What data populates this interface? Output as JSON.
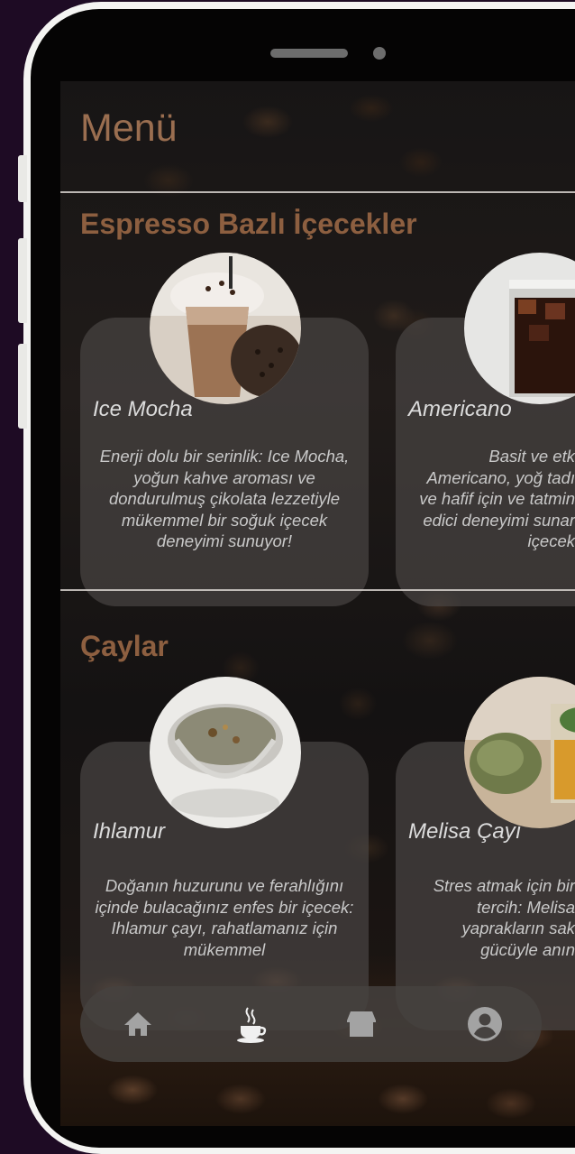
{
  "page": {
    "title": "Menü"
  },
  "sections": [
    {
      "title": "Espresso Bazlı İçecekler",
      "items": [
        {
          "name": "Ice Mocha",
          "description": "Enerji dolu bir serinlik: Ice Mocha, yoğun kahve aroması ve dondurulmuş çikolata lezzetiyle mükemmel bir soğuk içecek deneyimi sunuyor!"
        },
        {
          "name": "Americano",
          "description": "Basit ve etk Americano, yoğ tadı ve hafif için ve tatmin edici deneyimi sunar içecek"
        }
      ]
    },
    {
      "title": "Çaylar",
      "items": [
        {
          "name": "Ihlamur",
          "description": "Doğanın huzurunu ve ferahlığını içinde bulacağınız enfes bir içecek: Ihlamur çayı, rahatlamanız için mükemmel"
        },
        {
          "name": "Melisa Çayı",
          "description": "Stres atmak için bir tercih: Melisa yaprakların sak gücüyle anın"
        }
      ]
    }
  ],
  "nav": [
    {
      "icon": "home-icon"
    },
    {
      "icon": "coffee-cup-icon"
    },
    {
      "icon": "store-icon"
    },
    {
      "icon": "account-icon"
    }
  ],
  "colors": {
    "accent": "#9a6e50",
    "section_title": "#8d5f40",
    "card_bg": "#484442",
    "nav_bg": "#464240",
    "background": "#1e0b24"
  }
}
